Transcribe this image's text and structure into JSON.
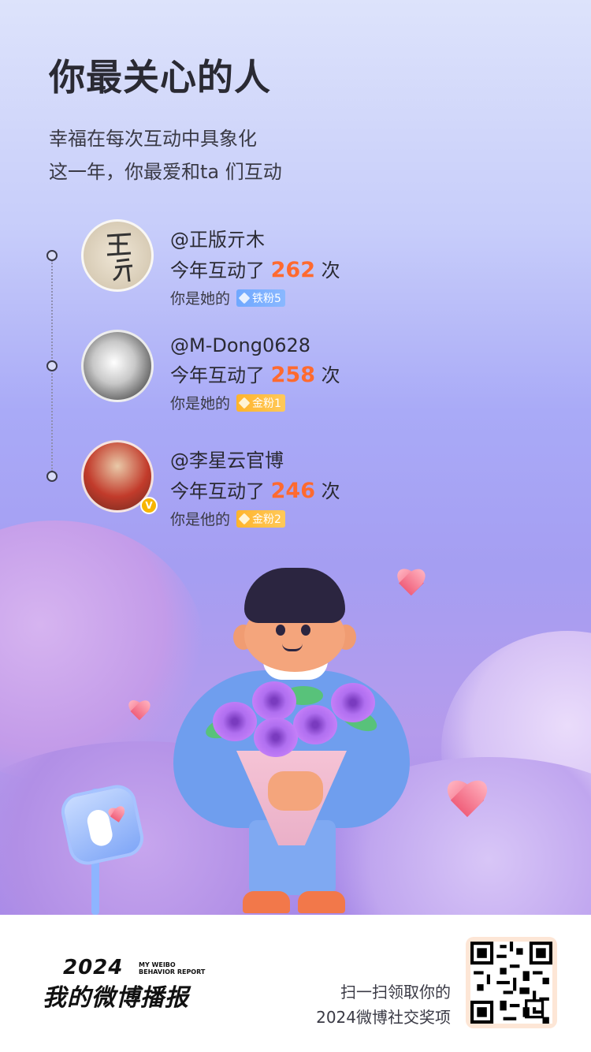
{
  "header": {
    "title": "你最关心的人",
    "subtitle_line1": "幸福在每次互动中具象化",
    "subtitle_line2": "这一年，你最爱和ta 们互动"
  },
  "users": [
    {
      "name": "@正版亓木",
      "interaction_prefix": "今年互动了",
      "count": "262",
      "interaction_suffix": "次",
      "relation": "你是她的",
      "badge": "铁粉5",
      "badge_type": "iron",
      "avatar_text": "正版亓木"
    },
    {
      "name": "@M-Dong0628",
      "interaction_prefix": "今年互动了",
      "count": "258",
      "interaction_suffix": "次",
      "relation": "你是她的",
      "badge": "金粉1",
      "badge_type": "gold"
    },
    {
      "name": "@李星云官博",
      "interaction_prefix": "今年互动了",
      "count": "246",
      "interaction_suffix": "次",
      "relation": "你是他的",
      "badge": "金粉2",
      "badge_type": "gold",
      "verified_icon": "v-verified-icon"
    }
  ],
  "footer": {
    "brand_year": "2024",
    "brand_en": "MY WEIBO BEHAVIOR REPORT",
    "brand_cn": "我的微博播报",
    "scan_line1": "扫一扫领取你的",
    "scan_line2": "2024微博社交奖项"
  },
  "colors": {
    "accent_count": "#ff6a2f",
    "badge_iron": "#6fa8ff",
    "badge_gold": "#ffb42c"
  },
  "icons": [
    "diamond-icon",
    "verified-v-icon",
    "heart-icon",
    "qr-code"
  ]
}
